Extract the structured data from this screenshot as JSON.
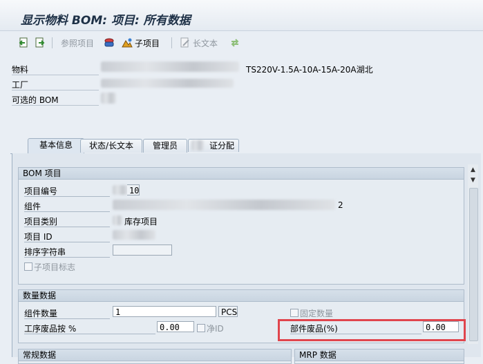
{
  "window": {
    "title": "显示物料 BOM: 项目: 所有数据"
  },
  "toolbar": {
    "ref_item_label": "参照项目",
    "sub_item_label": "子项目",
    "long_text_label": "长文本"
  },
  "header": {
    "material_label": "物料",
    "material_value": "TS220V-1.5A-10A-15A-20A湖北",
    "plant_label": "工厂",
    "alt_bom_label": "可选的 BOM"
  },
  "tabs": [
    "基本信息",
    "状态/长文本",
    "管理员",
    "证分配"
  ],
  "bom_item": {
    "title": "BOM 项目",
    "item_no_label": "项目编号",
    "item_no_value": "10",
    "component_label": "组件",
    "component_suffix": "2",
    "item_category_label": "项目类别",
    "item_category_text": "库存项目",
    "item_id_label": "项目 ID",
    "sort_string_label": "排序字符串",
    "sub_item_flag_label": "子项目标志"
  },
  "quantity": {
    "title": "数量数据",
    "component_qty_label": "组件数量",
    "component_qty_value": "1",
    "unit": "PCS",
    "fixed_qty_label": "固定数量",
    "op_scrap_label": "工序废品按 %",
    "op_scrap_value": "0.00",
    "net_id_label": "净ID",
    "comp_scrap_label": "部件废品(%)",
    "comp_scrap_value": "0.00"
  },
  "bottom_groups": {
    "left_title": "常规数据",
    "right_title": "MRP 数据"
  }
}
